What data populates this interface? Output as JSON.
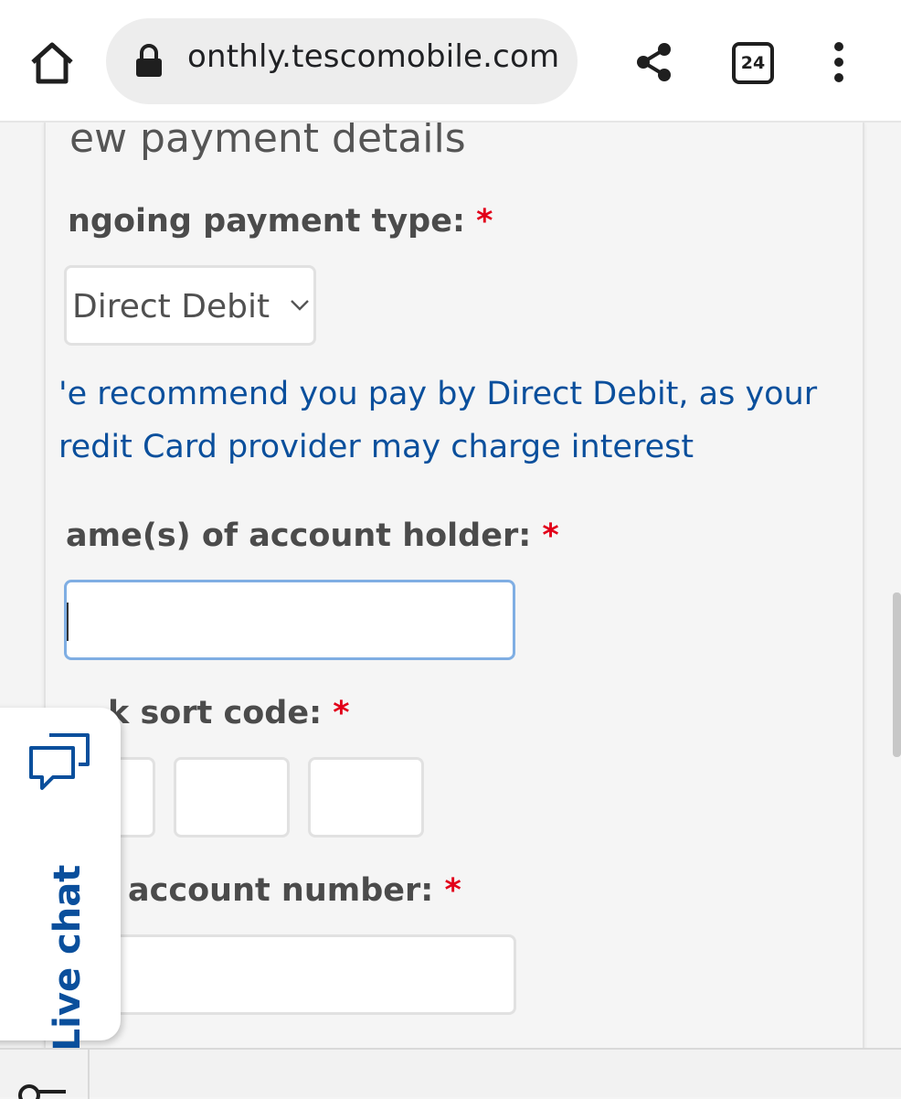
{
  "browser": {
    "url": "onthly.tescomobile.com",
    "tab_count": "24",
    "icons": [
      "home-icon",
      "lock-icon",
      "share-icon",
      "tabs-icon",
      "overflow-menu-icon"
    ]
  },
  "form": {
    "section_title": "ew payment details",
    "payment_type": {
      "label": "ngoing payment type:",
      "required_mark": "*",
      "selected": "Direct Debit"
    },
    "recommendation": {
      "line1": "'e recommend you pay by Direct Debit, as your",
      "line2": "redit Card provider may charge interest"
    },
    "account_holder": {
      "label": "ame(s) of account holder:",
      "required_mark": "*",
      "value": ""
    },
    "sort_code": {
      "label": "k sort code:",
      "required_mark": "*",
      "parts": [
        "",
        "",
        ""
      ]
    },
    "account_number": {
      "label": "account number:",
      "required_mark": "*",
      "value": ""
    }
  },
  "live_chat": {
    "label": "Live chat"
  },
  "colors": {
    "link_blue": "#0a4f9c",
    "required_red": "#e2001a",
    "focus_border": "#7faee3"
  }
}
